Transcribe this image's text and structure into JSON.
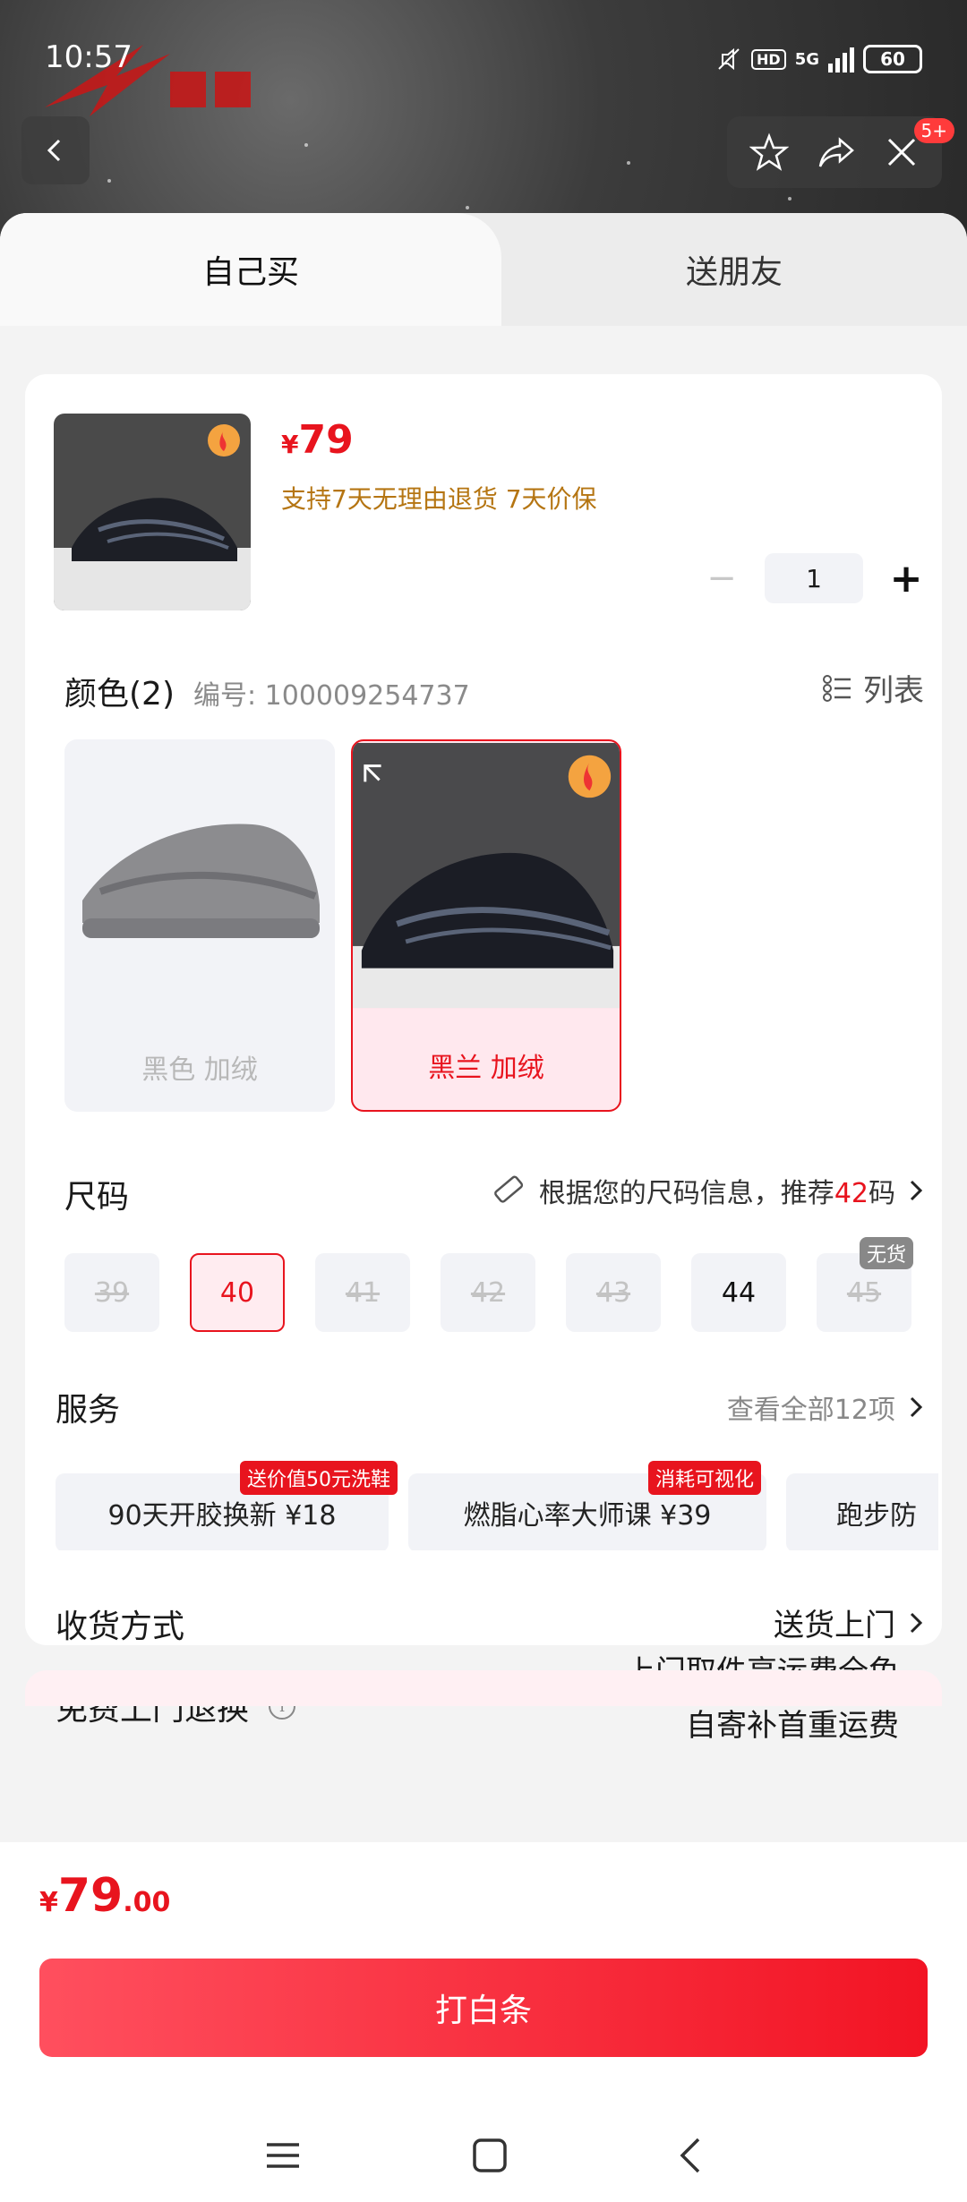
{
  "status_bar": {
    "time": "10:57",
    "network": "5G",
    "hd": "HD",
    "battery": "60"
  },
  "header": {
    "badge": "5+"
  },
  "tabs": [
    {
      "label": "自己买"
    },
    {
      "label": "送朋友"
    }
  ],
  "product": {
    "currency": "¥",
    "price": "79",
    "return_policy": "支持7天无理由退货  7天价保",
    "quantity": "1"
  },
  "color": {
    "title": "颜色(2)",
    "code": "编号: 100009254737",
    "list_label": "列表",
    "options": [
      {
        "label": "黑色 加绒"
      },
      {
        "label": "黑兰 加绒"
      }
    ]
  },
  "size": {
    "title": "尺码",
    "recommend_prefix": "根据您的尺码信息，推荐",
    "recommend_value": "42",
    "recommend_suffix": "码",
    "options": [
      {
        "label": "39"
      },
      {
        "label": "40"
      },
      {
        "label": "41"
      },
      {
        "label": "42"
      },
      {
        "label": "43"
      },
      {
        "label": "44"
      },
      {
        "label": "45"
      }
    ],
    "out_of_stock_tag": "无货"
  },
  "service": {
    "title": "服务",
    "view_all": "查看全部12项",
    "items": [
      {
        "label": "90天开胶换新  ¥18",
        "tag": "送价值50元洗鞋"
      },
      {
        "label": "燃脂心率大师课  ¥39",
        "tag": "消耗可视化"
      },
      {
        "label": "跑步防"
      }
    ]
  },
  "delivery": {
    "title": "收货方式",
    "value": "送货上门"
  },
  "free_return": {
    "title": "免费上门退换",
    "line1": "上门取件享运费全免",
    "line2": "自寄补首重运费"
  },
  "bottom": {
    "currency": "¥",
    "price_int": "79",
    "price_dec": ".00",
    "buy_label": "打白条"
  },
  "colors": {
    "accent": "#e8141e",
    "gold": "#b57512"
  }
}
